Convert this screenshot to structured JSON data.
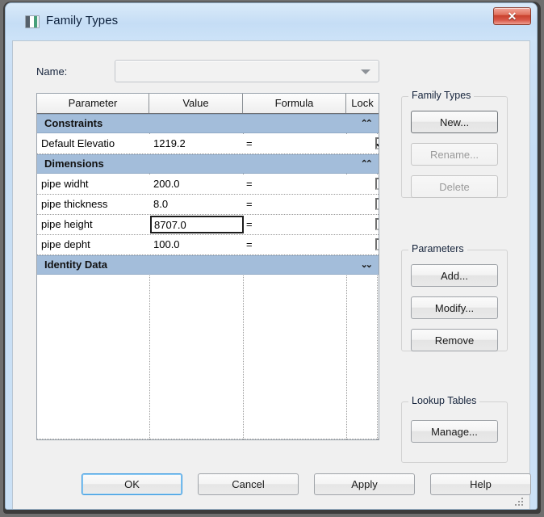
{
  "window": {
    "title": "Family Types",
    "icon": "family-file-icon",
    "close_label": "✕"
  },
  "name_field": {
    "label": "Name:",
    "value": "",
    "placeholder": "",
    "dropdown_icon": "chevron-down-icon"
  },
  "grid": {
    "columns": [
      "Parameter",
      "Value",
      "Formula",
      "Lock"
    ],
    "groups": [
      {
        "label": "Constraints",
        "chevron": "⌃⌃",
        "collapse_icon": "double-chevron-up-icon",
        "rows": [
          {
            "parameter": "Default Elevatio",
            "value": "1219.2",
            "formula": "=",
            "locked": true,
            "editing": false
          }
        ]
      },
      {
        "label": "Dimensions",
        "chevron": "⌃⌃",
        "collapse_icon": "double-chevron-up-icon",
        "rows": [
          {
            "parameter": "pipe widht",
            "value": "200.0",
            "formula": "=",
            "locked": false,
            "editing": false
          },
          {
            "parameter": "pipe thickness",
            "value": "8.0",
            "formula": "=",
            "locked": false,
            "editing": false
          },
          {
            "parameter": "pipe height",
            "value": "8707.0",
            "formula": "=",
            "locked": false,
            "editing": true
          },
          {
            "parameter": "pipe depht",
            "value": "100.0",
            "formula": "=",
            "locked": false,
            "editing": false
          }
        ]
      },
      {
        "label": "Identity Data",
        "chevron": "⌄⌄",
        "collapse_icon": "double-chevron-down-icon",
        "rows": []
      }
    ]
  },
  "panels": [
    {
      "title": "Family Types",
      "buttons": [
        {
          "label": "New...",
          "enabled": true
        },
        {
          "label": "Rename...",
          "enabled": false
        },
        {
          "label": "Delete",
          "enabled": false
        }
      ]
    },
    {
      "title": "Parameters",
      "buttons": [
        {
          "label": "Add...",
          "enabled": true
        },
        {
          "label": "Modify...",
          "enabled": true
        },
        {
          "label": "Remove",
          "enabled": true
        }
      ]
    },
    {
      "title": "Lookup Tables",
      "buttons": [
        {
          "label": "Manage...",
          "enabled": true
        }
      ]
    }
  ],
  "footer": {
    "ok": "OK",
    "cancel": "Cancel",
    "apply": "Apply",
    "help": "Help",
    "default_button": "OK"
  },
  "colors": {
    "group_header_bg": "#a3bdda",
    "titlebar": "#c5ddf5",
    "dialog_bg": "#f0f0f0",
    "close_button": "#c8402c",
    "default_button_focus": "#3d9ae0"
  }
}
